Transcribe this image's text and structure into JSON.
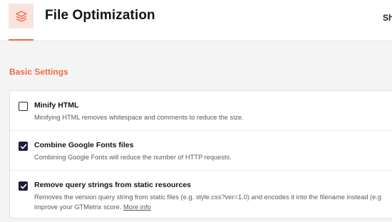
{
  "header": {
    "title": "File Optimization",
    "right_text": "Sh",
    "icon": "layers-icon"
  },
  "section": {
    "title": "Basic Settings"
  },
  "colors": {
    "accent": "#ef6b47",
    "checkbox_checked": "#1d1d3a"
  },
  "settings": [
    {
      "label": "Minify HTML",
      "description": "Minifying HTML removes whitespace and comments to reduce the size.",
      "checked": false
    },
    {
      "label": "Combine Google Fonts files",
      "description": "Combining Google Fonts will reduce the number of HTTP requests.",
      "checked": true
    },
    {
      "label": "Remove query strings from static resources",
      "description_line1": "Removes the version query string from static files (e.g. style.css?ver=1.0) and encodes it into the filename instead (e.g",
      "description_line2": "improve your GTMetrix score.",
      "link_text": "More info",
      "checked": true
    }
  ]
}
